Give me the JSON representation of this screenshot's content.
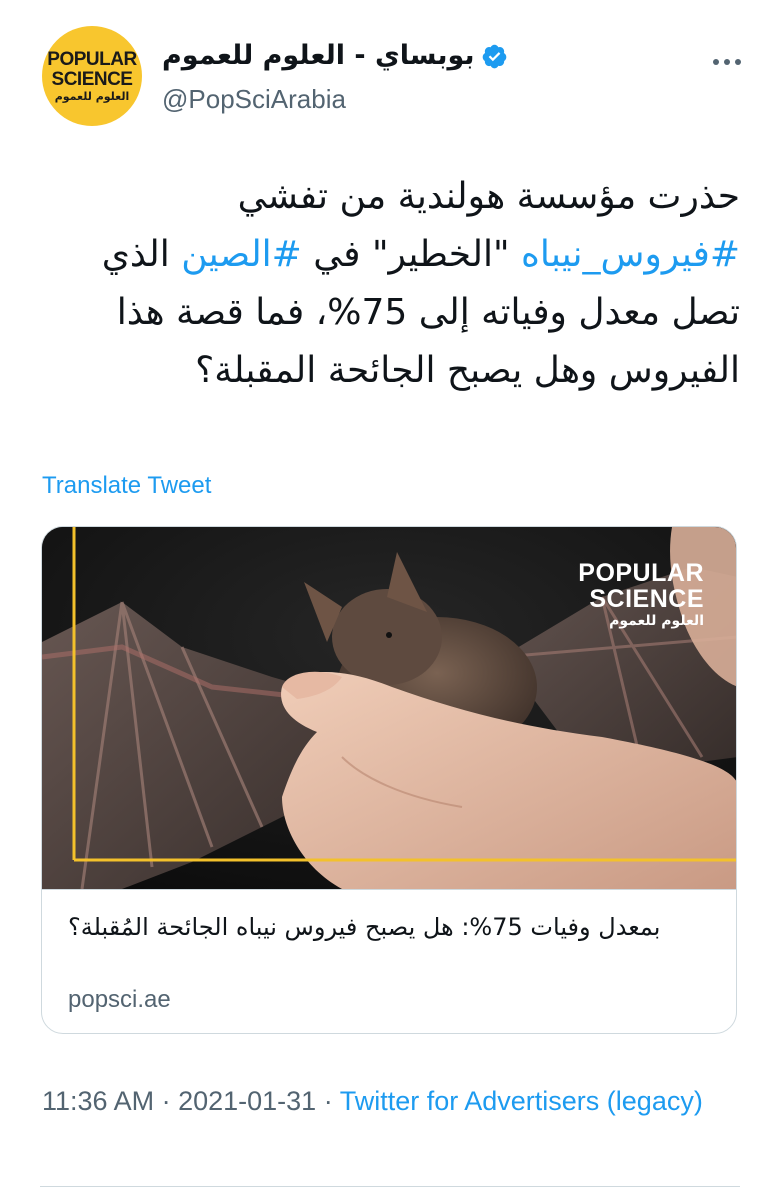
{
  "author": {
    "avatar": {
      "line1": "POPULAR",
      "line2": "SCIENCE",
      "line3": "العلوم للعموم"
    },
    "display_name": "بوبساي - العلوم للعموم",
    "handle": "@PopSciArabia",
    "verified": true
  },
  "tweet": {
    "parts": [
      {
        "text": "حذرت مؤسسة هولندية من تفشي ",
        "link": false
      },
      {
        "text": "#فيروس_نيباه",
        "link": true
      },
      {
        "text": " \"الخطير\" في ",
        "link": false
      },
      {
        "text": "#الصين",
        "link": true
      },
      {
        "text": " الذي تصل معدل وفياته إلى 75%، فما قصة هذا الفيروس وهل يصبح الجائحة المقبلة؟",
        "link": false
      }
    ],
    "translate_label": "Translate Tweet"
  },
  "card": {
    "brand": {
      "line1": "POPULAR",
      "line2": "SCIENCE",
      "line3": "العلوم للعموم"
    },
    "title": "بمعدل وفيات 75%: هل يصبح فيروس نيباه الجائحة المُقبلة؟",
    "domain": "popsci.ae"
  },
  "meta": {
    "time": "11:36 AM",
    "sep1": " · ",
    "date": "2021-01-31",
    "sep2": " · ",
    "source": "Twitter for Advertisers (legacy)"
  },
  "colors": {
    "link": "#1d9bf0",
    "secondary_text": "#536471",
    "avatar_bg": "#f8c62e",
    "border": "#cfd9de"
  },
  "icons": [
    "verified-badge-icon",
    "more-options-icon"
  ]
}
